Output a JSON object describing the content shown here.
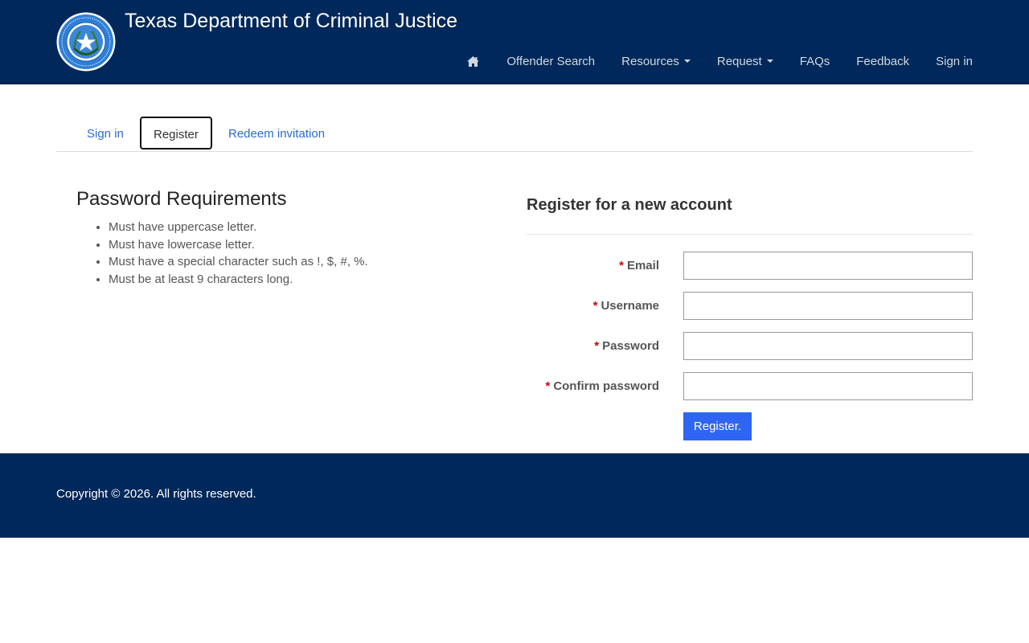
{
  "header": {
    "title": "Texas Department of Criminal Justice",
    "nav": {
      "home_icon": "home-icon",
      "offender_search": "Offender Search",
      "resources": "Resources",
      "request": "Request",
      "faqs": "FAQs",
      "feedback": "Feedback",
      "sign_in": "Sign in"
    },
    "colors": {
      "background": "#00285a",
      "nav_text": "#cfd8e3"
    }
  },
  "tabs": [
    {
      "label": "Sign in",
      "active": false
    },
    {
      "label": "Register",
      "active": true
    },
    {
      "label": "Redeem invitation",
      "active": false
    }
  ],
  "password_requirements": {
    "title": "Password Requirements",
    "items": [
      "Must have uppercase letter.",
      "Must have lowercase letter.",
      "Must have a special character such as !, $, #, %.",
      "Must be at least 9 characters long."
    ]
  },
  "register_form": {
    "title": "Register for a new account",
    "required_marker": "*",
    "fields": [
      {
        "label": "Email",
        "value": ""
      },
      {
        "label": "Username",
        "value": ""
      },
      {
        "label": "Password",
        "value": ""
      },
      {
        "label": "Confirm password",
        "value": ""
      }
    ],
    "submit_label": "Register.",
    "colors": {
      "button": "#2e65f3",
      "required": "#cc0000"
    }
  },
  "footer": {
    "copyright": "Copyright © 2026. All rights reserved."
  }
}
